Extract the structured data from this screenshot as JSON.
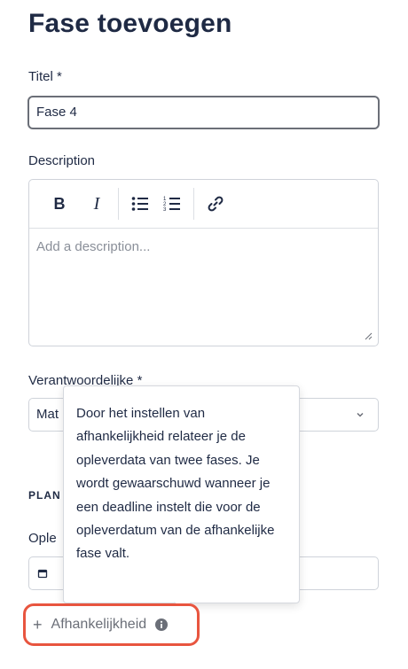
{
  "form": {
    "title": "Fase toevoegen",
    "title_label": "Titel *",
    "title_value": "Fase 4",
    "description_label": "Description",
    "description_placeholder": "Add a description...",
    "toolbar": {
      "bold": "B",
      "italic": "I"
    },
    "responsible_label": "Verantwoordelijke *",
    "responsible_value": "Mat",
    "planning_section": "PLAN",
    "delivery_label": "Ople",
    "dependency_button": "Afhankelijkheid"
  },
  "tooltip": {
    "text": "Door het instellen van afhankelijkheid relateer je de opleverdata van twee fases. Je wordt gewaarschuwd wanneer je een deadline instelt die voor de opleverdatum van de afhankelijke fase valt."
  },
  "colors": {
    "highlight": "#e8553f",
    "text": "#1f2a44",
    "muted": "#6b6f78"
  }
}
